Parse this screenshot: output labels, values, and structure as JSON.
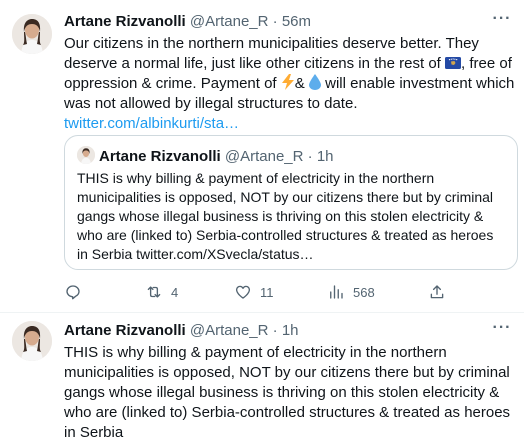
{
  "tweet1": {
    "author": "Artane Rizvanolli",
    "handle": "@Artane_R",
    "time": "56m",
    "text_p1": "Our citizens in the northern municipalities deserve better. They deserve a normal life, just like other citizens in the rest of ",
    "flag_emoji": "🇽🇰",
    "text_p2": ", free of oppression & crime. Payment of ",
    "bolt_emoji": "⚡",
    "text_p3": "& ",
    "drop_emoji": "💧",
    "text_p4": " will enable investment which was not allowed by illegal structures to date.",
    "link": "twitter.com/albinkurti/sta…",
    "quote": {
      "author": "Artane Rizvanolli",
      "handle": "@Artane_R",
      "time": "1h",
      "text": "THIS is why billing & payment of electricity in the northern municipalities is opposed, NOT by our citizens there but by criminal gangs whose illegal business is thriving on this stolen electricity & who are (linked to) Serbia-controlled structures & treated as heroes in Serbia twitter.com/XSvecla/status…"
    },
    "actions": {
      "replies": "",
      "retweets": "4",
      "likes": "11",
      "views": "568"
    }
  },
  "tweet2": {
    "author": "Artane Rizvanolli",
    "handle": "@Artane_R",
    "time": "1h",
    "text": "THIS is why billing & payment of electricity in the northern municipalities is opposed, NOT by our citizens there but by criminal gangs whose illegal business is thriving on this stolen electricity & who are (linked to) Serbia-controlled structures & treated as heroes in Serbia"
  },
  "icons": {
    "more": "more-icon",
    "reply": "reply-icon",
    "retweet": "retweet-icon",
    "like": "heart-icon",
    "views": "views-icon",
    "share": "share-icon"
  },
  "colors": {
    "link": "#1d9bf0",
    "muted": "#536471",
    "border": "#cfd9de"
  }
}
